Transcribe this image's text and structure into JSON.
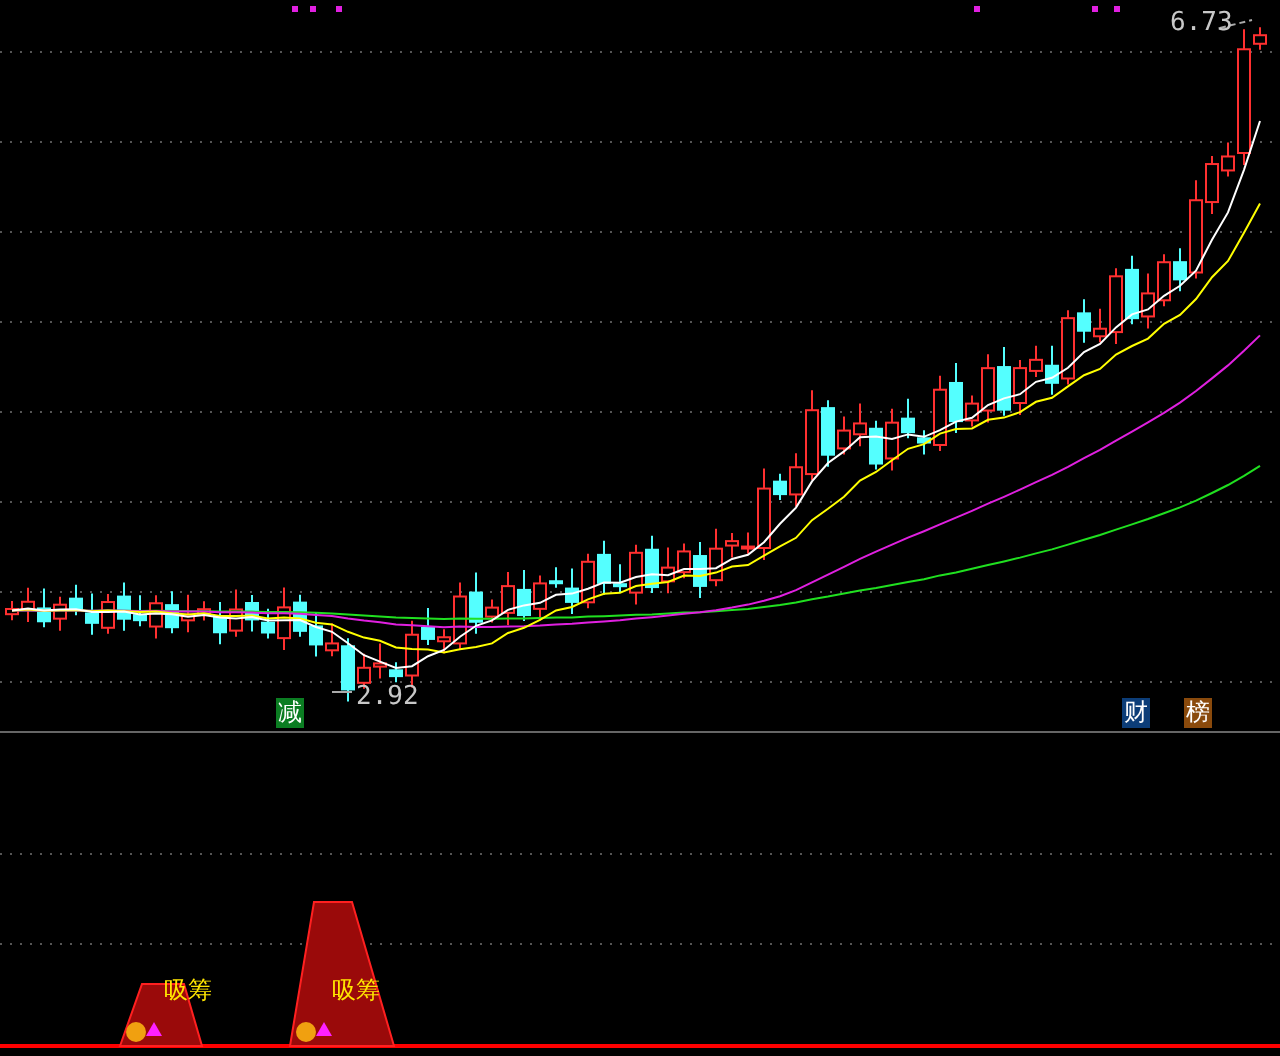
{
  "price_chart": {
    "high_label": "6.73",
    "low_label": "2.92"
  },
  "signals": [
    {
      "text": "减",
      "color": "#0b7d22"
    },
    {
      "text": "财",
      "color": "#0c3d78"
    },
    {
      "text": "榜",
      "color": "#8a4a0c"
    }
  ],
  "indicator": {
    "labels": [
      "吸筹",
      "吸筹"
    ]
  }
}
